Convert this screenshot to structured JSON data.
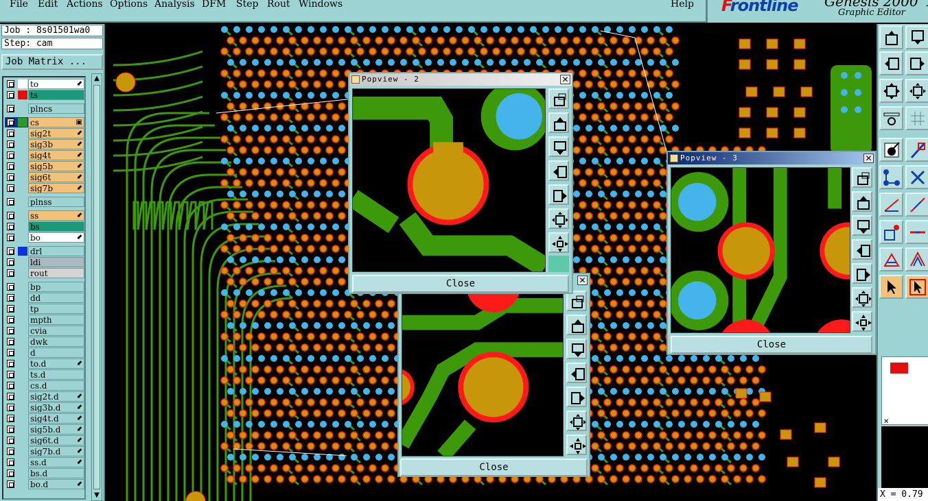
{
  "menus": [
    "File",
    "Edit",
    "Actions",
    "Options",
    "Analysis",
    "DFM",
    "Step",
    "Rout",
    "Windows"
  ],
  "help": "Help",
  "brand": {
    "logo_a": "F",
    "logo_b": "rontline",
    "product": "Genesis 2000",
    "subtitle": "Graphic Editor",
    "trailing": "X"
  },
  "job": {
    "job": "Job : 8s01501wa0",
    "step": "Step: cam",
    "matrix_label": "Job Matrix ..."
  },
  "layers": [
    {
      "name": "to",
      "bg": "#ffffff",
      "swatch": "#ffffff",
      "arrow": "⬋"
    },
    {
      "name": "ts",
      "bg": "#1a9a7a",
      "swatch": "#e01010",
      "arrow": ""
    },
    {
      "name": "plncs",
      "bg": "#9fd4d4",
      "swatch": "",
      "arrow": ""
    },
    {
      "name": "cs",
      "bg": "#f2c27a",
      "swatch": "#2a9a2a",
      "arrow": "▣",
      "sel": true
    },
    {
      "name": "sig2t",
      "bg": "#f2c27a",
      "swatch": "",
      "arrow": "⬋"
    },
    {
      "name": "sig3b",
      "bg": "#f2c27a",
      "swatch": "",
      "arrow": "⬋"
    },
    {
      "name": "sig4t",
      "bg": "#f2c27a",
      "swatch": "",
      "arrow": "⬋"
    },
    {
      "name": "sig5b",
      "bg": "#f2c27a",
      "swatch": "",
      "arrow": "⬋"
    },
    {
      "name": "sig6t",
      "bg": "#f2c27a",
      "swatch": "",
      "arrow": "⬋"
    },
    {
      "name": "sig7b",
      "bg": "#f2c27a",
      "swatch": "",
      "arrow": "⬋"
    },
    {
      "name": "plnss",
      "bg": "#9fd4d4",
      "swatch": "",
      "arrow": ""
    },
    {
      "name": "ss",
      "bg": "#f2c27a",
      "swatch": "",
      "arrow": "⬋"
    },
    {
      "name": "bs",
      "bg": "#1a9a7a",
      "swatch": "",
      "arrow": ""
    },
    {
      "name": "bo",
      "bg": "#ffffff",
      "swatch": "",
      "arrow": "⬋"
    },
    {
      "name": "drl",
      "bg": "#9fd4d4",
      "swatch": "#1030e0",
      "arrow": ""
    },
    {
      "name": "ldi",
      "bg": "#aab8c0",
      "swatch": "",
      "arrow": ""
    },
    {
      "name": "rout",
      "bg": "#d4d4d4",
      "swatch": "",
      "arrow": ""
    },
    {
      "name": "bp",
      "bg": "#9fd4d4",
      "swatch": "",
      "arrow": ""
    },
    {
      "name": "dd",
      "bg": "#9fd4d4",
      "swatch": "",
      "arrow": ""
    },
    {
      "name": "tp",
      "bg": "#9fd4d4",
      "swatch": "",
      "arrow": ""
    },
    {
      "name": "mpth",
      "bg": "#9fd4d4",
      "swatch": "",
      "arrow": ""
    },
    {
      "name": "cvia",
      "bg": "#9fd4d4",
      "swatch": "",
      "arrow": ""
    },
    {
      "name": "dwk",
      "bg": "#9fd4d4",
      "swatch": "",
      "arrow": ""
    },
    {
      "name": "d",
      "bg": "#9fd4d4",
      "swatch": "",
      "arrow": ""
    },
    {
      "name": "to.d",
      "bg": "#9fd4d4",
      "swatch": "",
      "arrow": "⬋"
    },
    {
      "name": "ts.d",
      "bg": "#9fd4d4",
      "swatch": "",
      "arrow": ""
    },
    {
      "name": "cs.d",
      "bg": "#9fd4d4",
      "swatch": "",
      "arrow": ""
    },
    {
      "name": "sig2t.d",
      "bg": "#9fd4d4",
      "swatch": "",
      "arrow": "⬋"
    },
    {
      "name": "sig3b.d",
      "bg": "#9fd4d4",
      "swatch": "",
      "arrow": "⬋"
    },
    {
      "name": "sig4t.d",
      "bg": "#9fd4d4",
      "swatch": "",
      "arrow": "⬋"
    },
    {
      "name": "sig5b.d",
      "bg": "#9fd4d4",
      "swatch": "",
      "arrow": "⬋"
    },
    {
      "name": "sig6t.d",
      "bg": "#9fd4d4",
      "swatch": "",
      "arrow": "⬋"
    },
    {
      "name": "sig7b.d",
      "bg": "#9fd4d4",
      "swatch": "",
      "arrow": "⬋"
    },
    {
      "name": "ss.d",
      "bg": "#9fd4d4",
      "swatch": "",
      "arrow": "⬋"
    },
    {
      "name": "bs.d",
      "bg": "#9fd4d4",
      "swatch": "",
      "arrow": ""
    },
    {
      "name": "bo.d",
      "bg": "#9fd4d4",
      "swatch": "",
      "arrow": "⬋"
    }
  ],
  "popups": [
    {
      "title": "Popview - 2",
      "close": "Close"
    },
    {
      "title": "",
      "close": "Close"
    },
    {
      "title": "Popview - 3",
      "close": "Close"
    }
  ],
  "coord": "X = 0.79",
  "colors": {
    "pad": "#c8960a",
    "ring": "#ff1a1a",
    "trace": "#3c9a0a",
    "via": "#45b4ea",
    "ui": "#9fd4d4"
  }
}
